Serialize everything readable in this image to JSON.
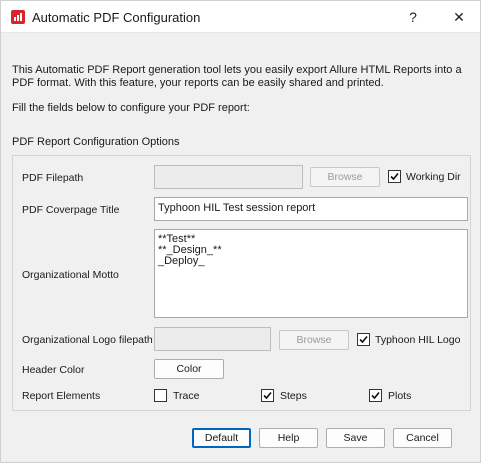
{
  "window": {
    "title": "Automatic PDF Configuration",
    "help_glyph": "?",
    "close_glyph": "✕"
  },
  "intro": {
    "description": "This Automatic PDF Report generation tool lets you easily export Allure HTML Reports into a PDF format. With this feature, your reports can be easily shared and printed.",
    "instruction": "Fill the fields below to configure your PDF report:"
  },
  "group": {
    "title": "PDF Report Configuration Options",
    "pdf_filepath": {
      "label": "PDF Filepath",
      "value": "",
      "browse_label": "Browse",
      "browse_enabled": false,
      "checkbox_label": "Working Dir",
      "checked": true
    },
    "coverpage_title": {
      "label": "PDF Coverpage Title",
      "value": "Typhoon HIL Test session report"
    },
    "motto": {
      "label": "Organizational Motto",
      "value": "**Test**\n**_Design_**\n_Deploy_"
    },
    "logo_filepath": {
      "label": "Organizational Logo filepath",
      "value": "",
      "browse_label": "Browse",
      "browse_enabled": false,
      "checkbox_label": "Typhoon HIL Logo",
      "checked": true
    },
    "header_color": {
      "label": "Header Color",
      "button_label": "Color"
    },
    "report_elements": {
      "label": "Report Elements",
      "items": [
        {
          "label": "Trace",
          "checked": false
        },
        {
          "label": "Steps",
          "checked": true
        },
        {
          "label": "Plots",
          "checked": true
        }
      ]
    }
  },
  "footer": {
    "default_label": "Default",
    "help_label": "Help",
    "save_label": "Save",
    "cancel_label": "Cancel"
  },
  "colors": {
    "app_icon": "#d7262b",
    "window_bg": "#f0f0f0",
    "titlebar_bg": "#ffffff"
  }
}
